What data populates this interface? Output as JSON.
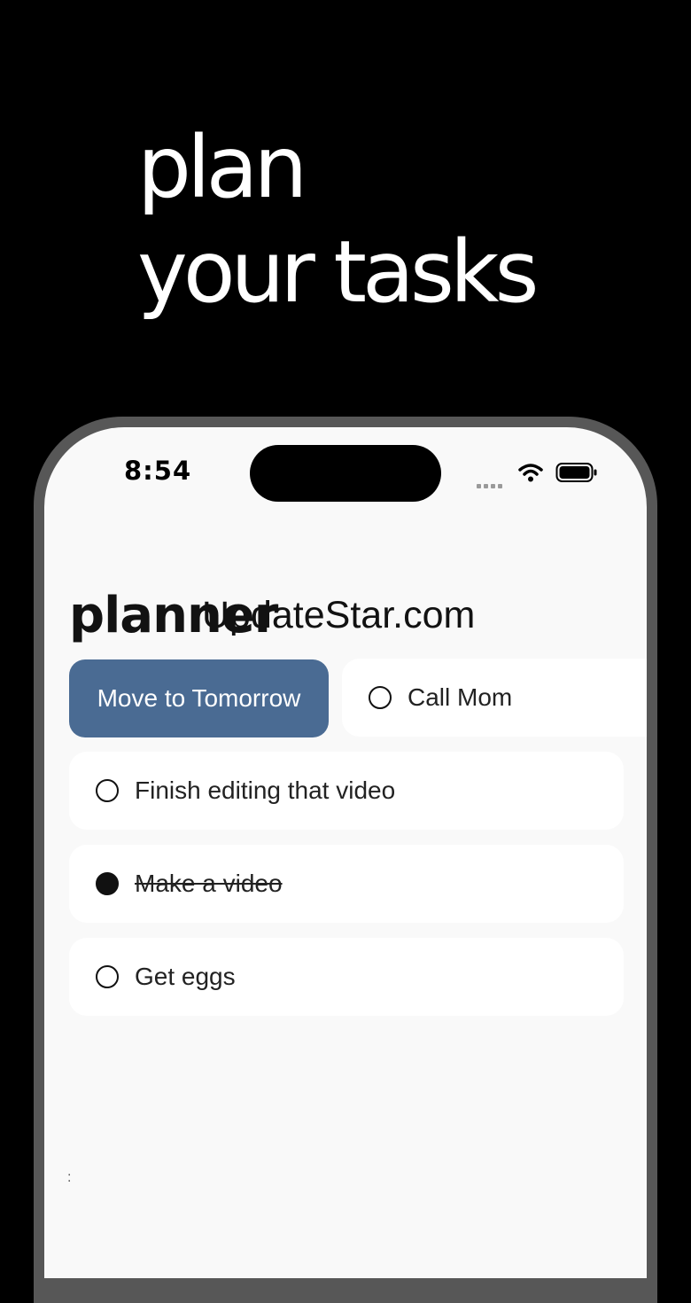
{
  "headline": {
    "line1": "plan",
    "line2": "your tasks"
  },
  "status_bar": {
    "time": "8:54"
  },
  "app": {
    "title": "planner",
    "watermark": "UpdateStar.com"
  },
  "swipe_action": {
    "label": "Move to Tomorrow",
    "color": "#4a6b93"
  },
  "tasks": [
    {
      "label": "Call Mom",
      "done": false
    },
    {
      "label": "Finish editing that video",
      "done": false
    },
    {
      "label": "Make a video",
      "done": true
    },
    {
      "label": "Get eggs",
      "done": false
    }
  ],
  "stray_mark": ":"
}
